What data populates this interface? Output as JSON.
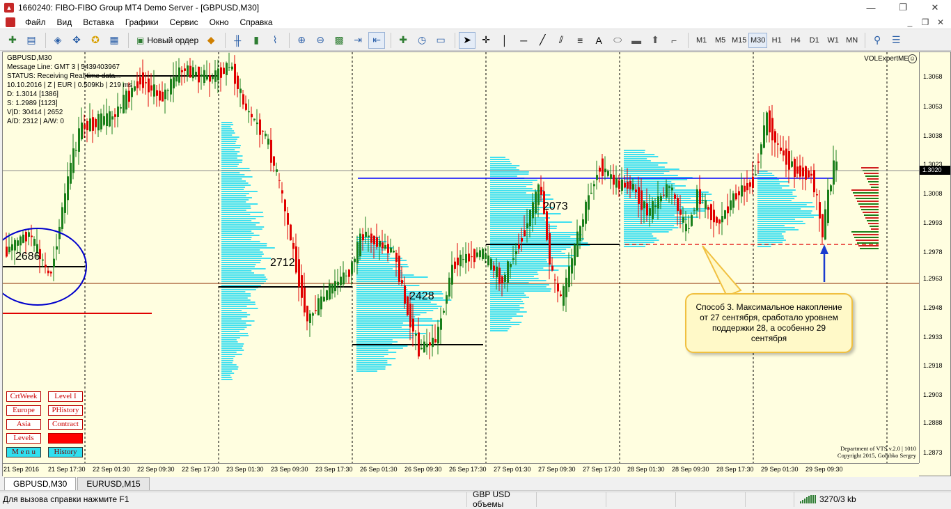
{
  "window": {
    "title": "1660240: FIBO-FIBO Group MT4 Demo Server - [GBPUSD,M30]",
    "minimize": "—",
    "maximize": "❐",
    "close": "✕"
  },
  "menu": {
    "items": [
      "Файл",
      "Вид",
      "Вставка",
      "Графики",
      "Сервис",
      "Окно",
      "Справка"
    ],
    "mdi_minimize": "_",
    "mdi_restore": "❐",
    "mdi_close": "✕"
  },
  "toolbar": {
    "new_order_label": "Новый ордер",
    "timeframes": [
      "M1",
      "M5",
      "M15",
      "M30",
      "H1",
      "H4",
      "D1",
      "W1",
      "MN"
    ],
    "active_timeframe": "M30"
  },
  "chart": {
    "symbol_line": "GBPUSD,M30",
    "info_lines": [
      "Message Line: GMT 3 | 5439403967",
      "STATUS:  Receiving Real-time data...",
      "10.10.2016 | Z | EUR | 0.509Kb | 219 ms",
      "D: 1.3014  [1386]",
      "S: 1.2989  [1123]",
      "V|D: 30414 | 2652",
      "A/D: 2312 | A/W: 0"
    ],
    "expert_name": "VOLExpertME",
    "expert_face": "☺",
    "current_price": "1.3020",
    "price_labels": [
      "1.3068",
      "1.3053",
      "1.3038",
      "1.3023",
      "1.3008",
      "1.2993",
      "1.2978",
      "1.2963",
      "1.2948",
      "1.2933",
      "1.2918",
      "1.2903",
      "1.2888",
      "1.2873"
    ],
    "time_labels": [
      "21 Sep 2016",
      "21 Sep 17:30",
      "22 Sep 01:30",
      "22 Sep 09:30",
      "22 Sep 17:30",
      "23 Sep 01:30",
      "23 Sep 09:30",
      "23 Sep 17:30",
      "26 Sep 01:30",
      "26 Sep 09:30",
      "26 Sep 17:30",
      "27 Sep 01:30",
      "27 Sep 09:30",
      "27 Sep 17:30",
      "28 Sep 01:30",
      "28 Sep 09:30",
      "28 Sep 17:30",
      "29 Sep 01:30",
      "29 Sep 09:30"
    ],
    "volume_labels": [
      "2686",
      "2712",
      "2428",
      "2073"
    ],
    "side_buttons": [
      "CrtWeek",
      "Level I",
      "Europe",
      "PHistory",
      "Asia",
      "Contract",
      "Levels",
      "",
      "M e n u",
      "History"
    ],
    "callout_text": "Способ 3. Максимальное накопление от 27 сентября, сработало уровнем поддержки 28, а особенно 29 сентября",
    "copyright_line1": "Department of VTS  v.2.0 | 1010",
    "copyright_line2": "Copyright 2015, Golubko Sergey",
    "colors": {
      "background": "#fffee0",
      "bull": "#1a7f1a",
      "bear": "#e00000",
      "volume_profile": "#3fe0f0",
      "poc": "#000000",
      "support_line": "#0000ff"
    }
  },
  "tabs": [
    "GBPUSD,M30",
    "EURUSD,M15"
  ],
  "status": {
    "help": "Для вызова справки нажмите F1",
    "profile": "GBP USD объемы",
    "connection": "3270/3 kb"
  }
}
